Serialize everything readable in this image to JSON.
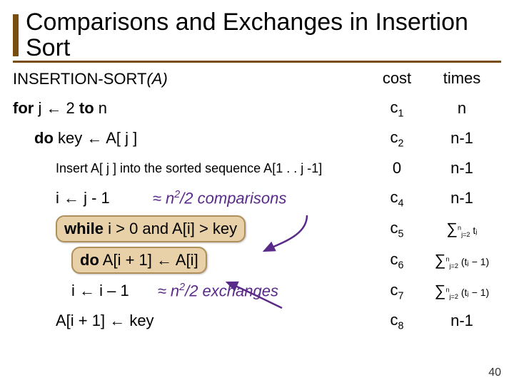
{
  "title": "Comparisons and Exchanges in Insertion Sort",
  "heading_prefix": "INSERTION-SORT",
  "heading_arg": "(A)",
  "col_cost": "cost",
  "col_times": "times",
  "rows": {
    "r1": {
      "code_b": "for",
      "code_rest": " j ← 2 ",
      "code_b2": "to",
      "code_tail": " n",
      "cost": "c",
      "cost_sub": "1",
      "times": "n"
    },
    "r2": {
      "code_b": "do",
      "code_rest": " key ← A[ j ]",
      "cost": "c",
      "cost_sub": "2",
      "times": "n-1"
    },
    "r3": {
      "comment": "Insert A[ j ] into the sorted sequence A[1 . . j -1]",
      "cost": "0",
      "times": "n-1"
    },
    "r4": {
      "code": "i ← j - 1",
      "note_approx": "≈ n",
      "note_sup": "2",
      "note_rest": "/2 comparisons",
      "cost": "c",
      "cost_sub": "4",
      "times": "n-1"
    },
    "r5": {
      "code_b": "while",
      "code_rest": " i > 0 and A[i] > key",
      "cost": "c",
      "cost_sub": "5",
      "sum_lo": "j=2",
      "sum_hi": "n",
      "sum_term": "tⱼ"
    },
    "r6": {
      "code_b": "do",
      "code_rest": " A[i + 1] ← A[i]",
      "cost": "c",
      "cost_sub": "6",
      "sum_lo": "j=2",
      "sum_hi": "n",
      "sum_term": "(tⱼ − 1)"
    },
    "r7": {
      "code": "i ← i – 1",
      "note_approx": "≈ n",
      "note_sup": "2",
      "note_rest": "/2 exchanges",
      "cost": "c",
      "cost_sub": "7",
      "sum_lo": "j=2",
      "sum_hi": "n",
      "sum_term": "(tⱼ − 1)"
    },
    "r8": {
      "code": "A[i + 1] ← key",
      "cost": "c",
      "cost_sub": "8",
      "times": "n-1"
    }
  },
  "page_number": "40"
}
